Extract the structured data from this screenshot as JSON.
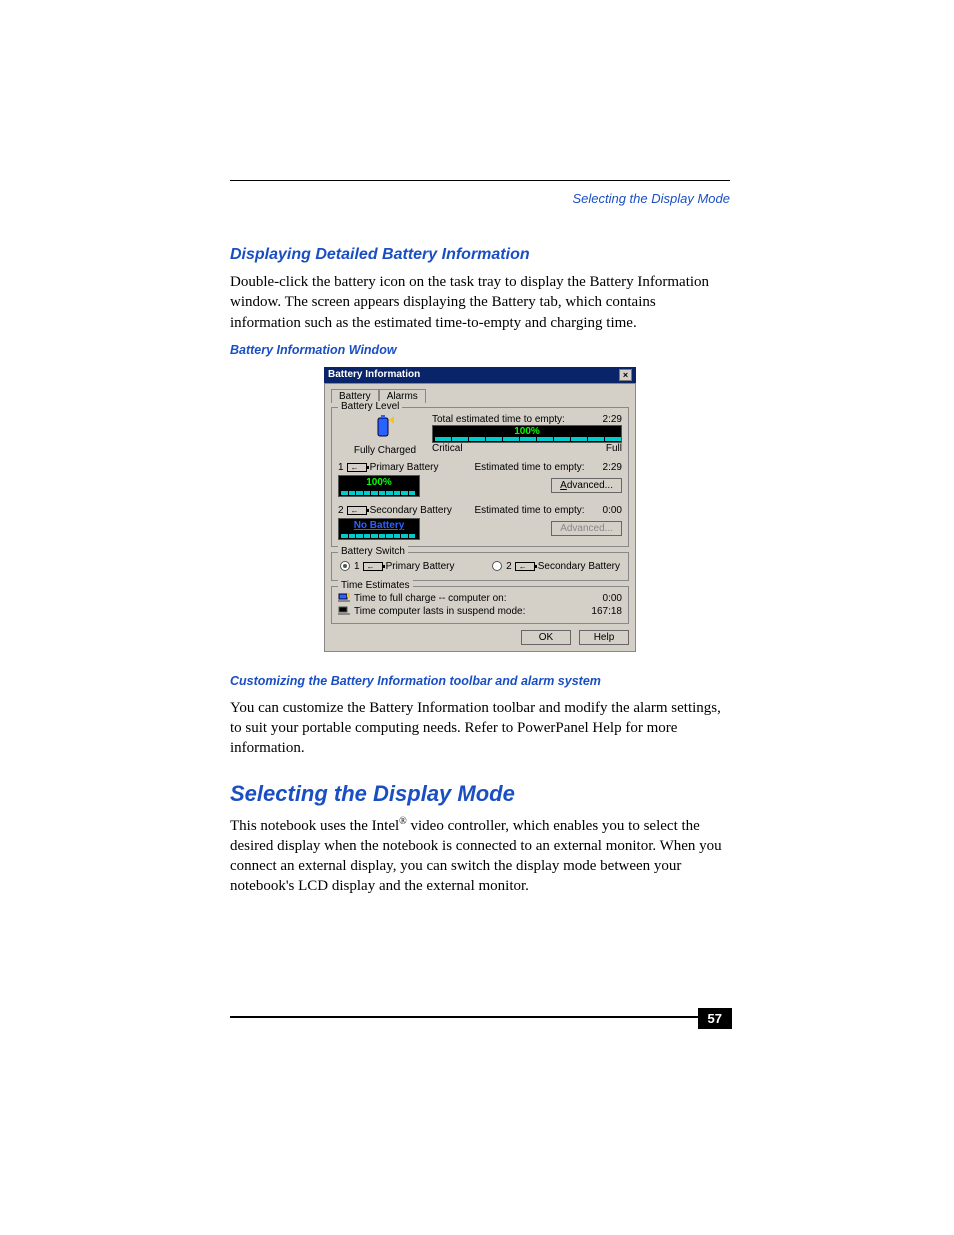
{
  "header_link": "Selecting the Display Mode",
  "h3_1": "Displaying Detailed Battery Information",
  "p1": "Double-click the battery icon on the task tray to display the Battery Information window. The screen appears displaying the Battery tab, which contains information such as the estimated time-to-empty and charging time.",
  "caption1": "Battery Information Window",
  "dialog": {
    "title": "Battery Information",
    "tabs": {
      "battery": "Battery",
      "alarms": "Alarms"
    },
    "group_level": "Battery Level",
    "fully_charged": "Fully Charged",
    "total_est_label": "Total estimated time to empty:",
    "total_est_value": "2:29",
    "meter_text": "100%",
    "critical": "Critical",
    "full": "Full",
    "primary_idx": "1",
    "primary_label": "Primary Battery",
    "primary_est_label": "Estimated time to empty:",
    "primary_est_value": "2:29",
    "primary_pct": "100%",
    "advanced": "Advanced...",
    "secondary_idx": "2",
    "secondary_label": "Secondary Battery",
    "secondary_est_label": "Estimated time to empty:",
    "secondary_est_value": "0:00",
    "secondary_text": "No Battery",
    "advanced2": "Advanced...",
    "group_switch": "Battery Switch",
    "switch_primary": "Primary Battery",
    "switch_secondary": "Secondary Battery",
    "group_time": "Time Estimates",
    "time_full_label": "Time to full charge -- computer on:",
    "time_full_value": "0:00",
    "time_suspend_label": "Time computer lasts in suspend mode:",
    "time_suspend_value": "167:18",
    "ok": "OK",
    "help": "Help"
  },
  "caption2": "Customizing the Battery Information toolbar and alarm system",
  "p2": "You can customize the Battery Information toolbar and modify the alarm settings, to suit your portable computing needs. Refer to PowerPanel Help for more information.",
  "h2": "Selecting the Display Mode",
  "p3a": "This notebook uses the Intel",
  "p3sup": "®",
  "p3b": " video controller, which enables you to select the desired display when the notebook is connected to an external monitor. When you connect an external display, you can switch the display mode between your notebook's LCD display and the external monitor.",
  "page_number": "57"
}
